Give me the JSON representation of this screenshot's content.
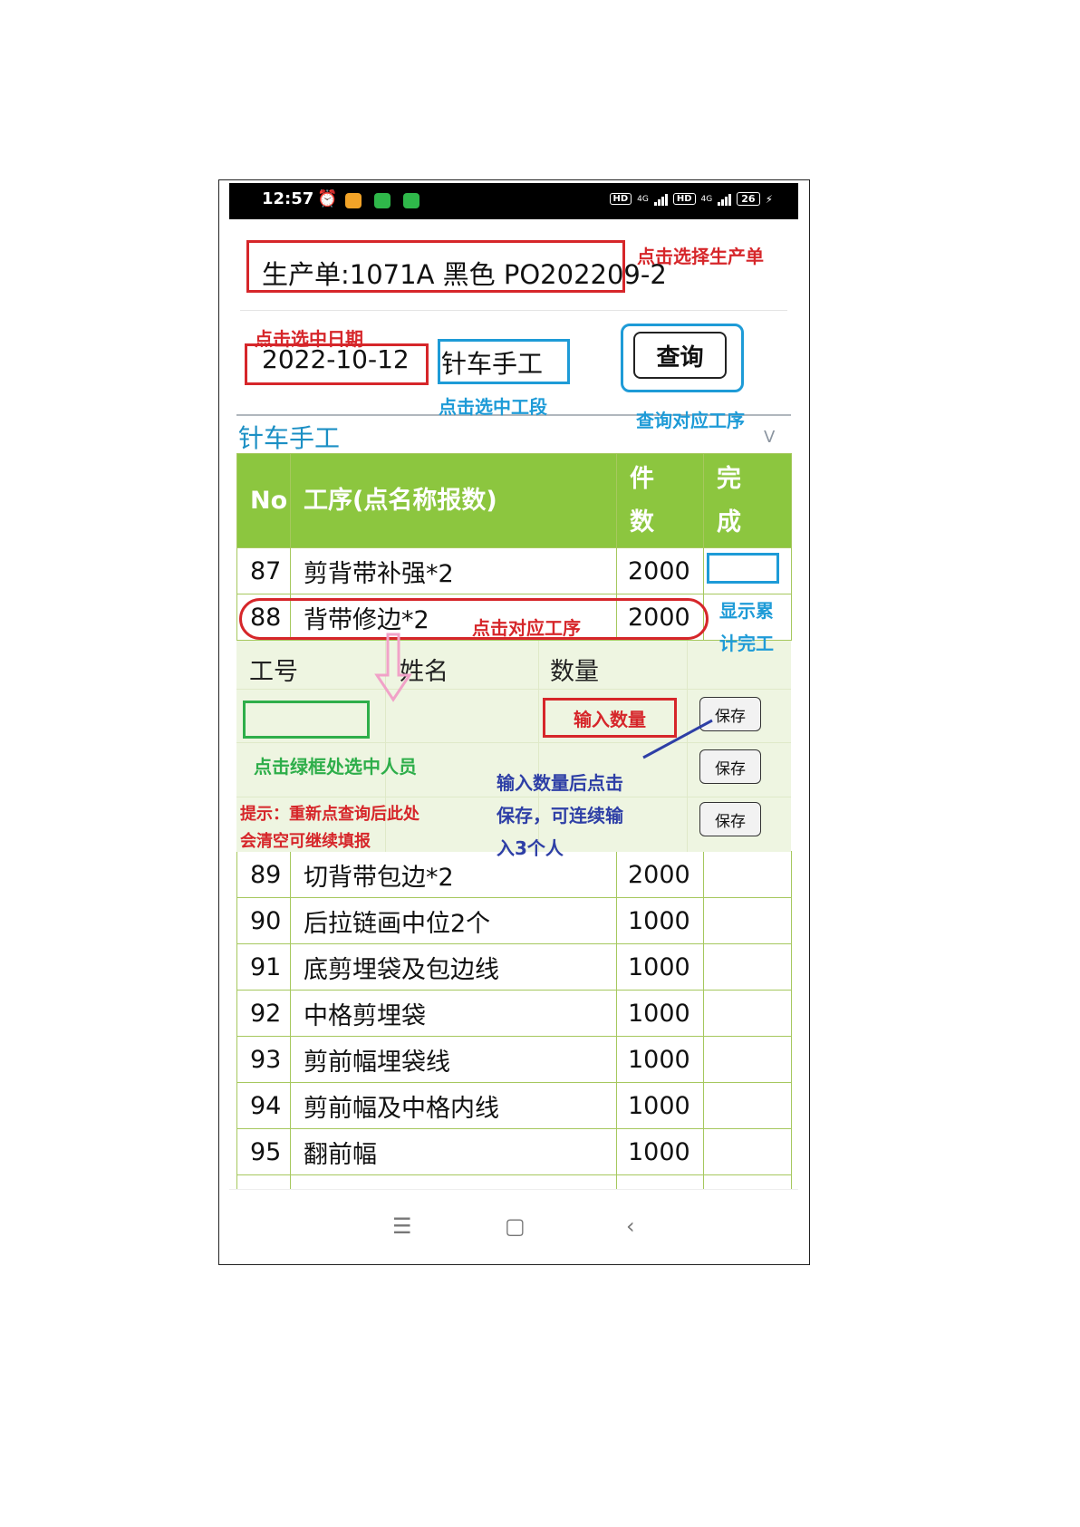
{
  "status_bar": {
    "time": "12:57",
    "hd1": "HD",
    "net1": "4G",
    "hd2": "HD",
    "net2": "4G",
    "battery": "26"
  },
  "order": {
    "text": "生产单:1071A  黑色  PO202209-2"
  },
  "filters": {
    "date": "2022-10-12",
    "section": "针车手工",
    "query_label": "查询"
  },
  "dropdown": {
    "label": "针车手工",
    "chevron": "V"
  },
  "table": {
    "headers": {
      "no": "No",
      "process": "工序(点名称报数)",
      "qty_l1": "件",
      "qty_l2": "数",
      "done_l1": "完",
      "done_l2": "成"
    },
    "rows_before": [
      {
        "no": "87",
        "name": "剪背带补强*2",
        "qty": "2000"
      },
      {
        "no": "88",
        "name": "背带修边*2",
        "qty": "2000"
      }
    ],
    "rows_after": [
      {
        "no": "89",
        "name": "切背带包边*2",
        "qty": "2000"
      },
      {
        "no": "90",
        "name": "后拉链画中位2个",
        "qty": "1000"
      },
      {
        "no": "91",
        "name": "底剪埋袋及包边线",
        "qty": "1000"
      },
      {
        "no": "92",
        "name": "中格剪埋袋",
        "qty": "1000"
      },
      {
        "no": "93",
        "name": "剪前幅埋袋线",
        "qty": "1000"
      },
      {
        "no": "94",
        "name": "剪前幅及中格内线",
        "qty": "1000"
      },
      {
        "no": "95",
        "name": "翻前幅",
        "qty": "1000"
      }
    ]
  },
  "sub_table": {
    "headers": {
      "worker_id": "工号",
      "name": "姓名",
      "qty": "数量"
    },
    "save_label": "保存"
  },
  "annotations": {
    "select_order": "点击选择生产单",
    "select_date": "点击选中日期",
    "select_section": "点击选中工段",
    "query_process": "查询对应工序",
    "click_process": "点击对应工序",
    "show_done_l1": "显示累",
    "show_done_l2": "计完工",
    "input_qty": "输入数量",
    "select_person": "点击绿框处选中人员",
    "tip_l1": "提示：重新点查询后此处",
    "tip_l2": "会清空可继续填报",
    "after_input_l1": "输入数量后点击",
    "after_input_l2": "保存，可连续输",
    "after_input_l3": "入3个人"
  },
  "colors": {
    "header_green": "#8cc63f",
    "accent_blue": "#1b8fc4",
    "annotation_red": "#d6262a",
    "annotation_green": "#2eae4a",
    "annotation_navy": "#2e3fa6"
  }
}
